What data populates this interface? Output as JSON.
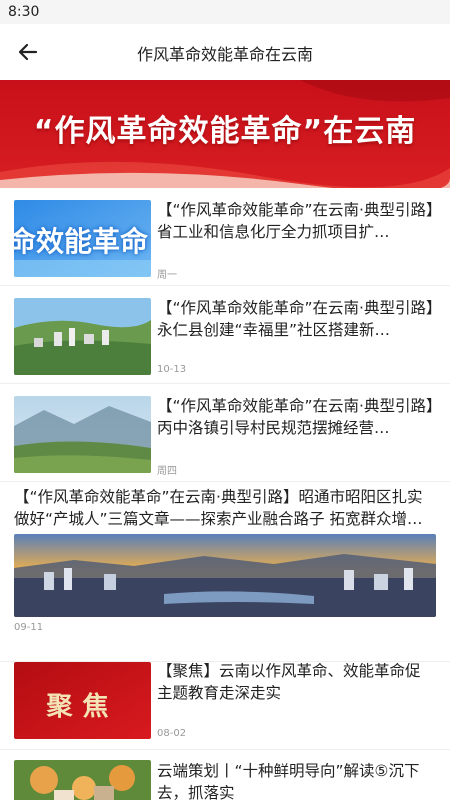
{
  "status_bar": {
    "time": "8:30"
  },
  "app_bar": {
    "title": "作风革命效能革命在云南"
  },
  "banner": {
    "text": "“作风革命效能革命”在云南"
  },
  "articles": [
    {
      "title": "【“作风革命效能革命”在云南·典型引路】省工业和信息化厅全力抓项目扩…",
      "date": "周一",
      "thumb_text": "命效能革命"
    },
    {
      "title": "【“作风革命效能革命”在云南·典型引路】永仁县创建“幸福里”社区搭建新…",
      "date": "10-13"
    },
    {
      "title": "【“作风革命效能革命”在云南·典型引路】丙中洛镇引导村民规范摆摊经营…",
      "date": "周四"
    },
    {
      "title": "【“作风革命效能革命”在云南·典型引路】昭通市昭阳区扎实做好“产城人”三篇文章——探索产业融合路子 拓宽群众增…",
      "date": "09-11"
    },
    {
      "title": "【聚焦】云南以作风革命、效能革命促主题教育走深走实",
      "date": "08-02",
      "thumb_text": "聚焦"
    },
    {
      "title": "云端策划丨“十种鲜明导向”解读⑤沉下去，抓落实",
      "date": ""
    }
  ]
}
